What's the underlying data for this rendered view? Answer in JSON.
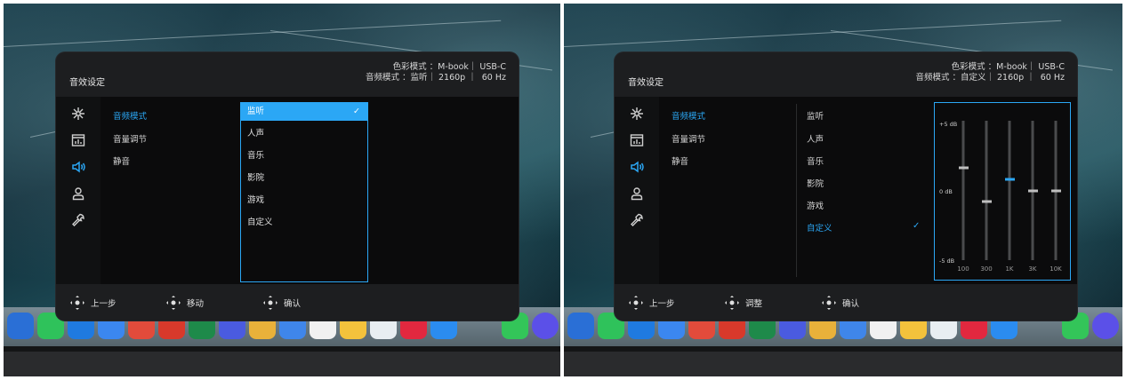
{
  "screens": [
    {
      "id": "left",
      "osd": {
        "title": "音效设定",
        "status_line1": "色彩模式 ：M-book｜ USB-C",
        "status_line2": "音频模式 ：监听｜ 2160p ｜  60 Hz",
        "side_icons": [
          "brightness-icon",
          "display-icon",
          "speaker-icon",
          "user-icon",
          "wrench-icon"
        ],
        "active_icon": 2,
        "menu_items": [
          {
            "label": "音频模式",
            "active": true
          },
          {
            "label": "音量调节",
            "active": false
          },
          {
            "label": "静音",
            "active": false
          }
        ],
        "options": [
          {
            "label": "监听",
            "selected": true
          },
          {
            "label": "人声",
            "selected": false
          },
          {
            "label": "音乐",
            "selected": false
          },
          {
            "label": "影院",
            "selected": false
          },
          {
            "label": "游戏",
            "selected": false
          },
          {
            "label": "自定义",
            "selected": false
          }
        ],
        "footer": [
          {
            "label": "上一步",
            "icon": "joystick-left-icon"
          },
          {
            "label": "移动",
            "icon": "joystick-updown-icon"
          },
          {
            "label": "确认",
            "icon": "joystick-press-icon"
          }
        ]
      }
    },
    {
      "id": "right",
      "osd": {
        "title": "音效设定",
        "status_line1": "色彩模式 ：M-book｜ USB-C",
        "status_line2": "音频模式 ：自定义｜ 2160p ｜  60 Hz",
        "side_icons": [
          "brightness-icon",
          "display-icon",
          "speaker-icon",
          "user-icon",
          "wrench-icon"
        ],
        "active_icon": 2,
        "menu_items": [
          {
            "label": "音频模式",
            "active": true
          },
          {
            "label": "音量调节",
            "active": false
          },
          {
            "label": "静音",
            "active": false
          }
        ],
        "options": [
          {
            "label": "监听",
            "active": false
          },
          {
            "label": "人声",
            "active": false
          },
          {
            "label": "音乐",
            "active": false
          },
          {
            "label": "影院",
            "active": false
          },
          {
            "label": "游戏",
            "active": false
          },
          {
            "label": "自定义",
            "active": true
          }
        ],
        "equalizer": {
          "max_label": "+5 dB",
          "mid_label": "0 dB",
          "min_label": "-5 dB",
          "range": [
            -5,
            5
          ],
          "bands": [
            {
              "freq": "100",
              "gain": 1.6
            },
            {
              "freq": "300",
              "gain": -0.8
            },
            {
              "freq": "1K",
              "gain": 0.8,
              "active": true
            },
            {
              "freq": "3K",
              "gain": 0
            },
            {
              "freq": "10K",
              "gain": 0
            }
          ]
        },
        "footer": [
          {
            "label": "上一步",
            "icon": "joystick-left-icon"
          },
          {
            "label": "调整",
            "icon": "joystick-updown-icon"
          },
          {
            "label": "确认",
            "icon": "joystick-press-icon"
          }
        ]
      }
    }
  ],
  "colors": {
    "accent": "#2ba7f5",
    "panel": "#1d1e20",
    "body": "#0b0b0c"
  }
}
